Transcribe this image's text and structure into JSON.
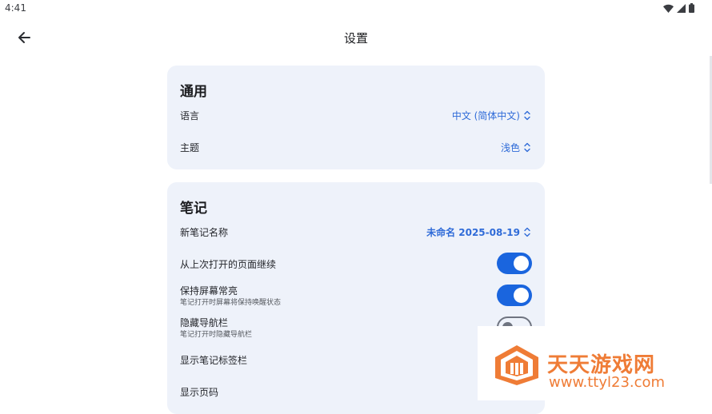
{
  "status_bar": {
    "time": "4:41",
    "icons": [
      "wifi-icon",
      "signal-icon",
      "battery-icon"
    ]
  },
  "app_bar": {
    "title": "设置",
    "back_icon": "arrow-left-icon"
  },
  "colors": {
    "accent": "#1a65de",
    "card_bg": "#eef2fa",
    "value_text": "#2f6bd8",
    "watermark": "#ef7c36"
  },
  "general": {
    "title": "通用",
    "language": {
      "label": "语言",
      "value": "中文 (简体中文)"
    },
    "theme": {
      "label": "主题",
      "value": "浅色"
    }
  },
  "notes": {
    "title": "笔记",
    "new_note_name": {
      "label": "新笔记名称",
      "value": "未命名 2025-08-19"
    },
    "resume_last_page": {
      "label": "从上次打开的页面继续",
      "on": true
    },
    "keep_screen_on": {
      "label": "保持屏幕常亮",
      "sublabel": "笔记打开时屏幕将保持唤醒状态",
      "on": true
    },
    "hide_nav_bar": {
      "label": "隐藏导航栏",
      "sublabel": "笔记打开时隐藏导航栏",
      "on": false
    },
    "show_note_tags": {
      "label": "显示笔记标签栏"
    },
    "show_page_number": {
      "label": "显示页码"
    }
  },
  "watermark": {
    "name": "天天游戏网",
    "url": "www.ttyl23.com"
  }
}
